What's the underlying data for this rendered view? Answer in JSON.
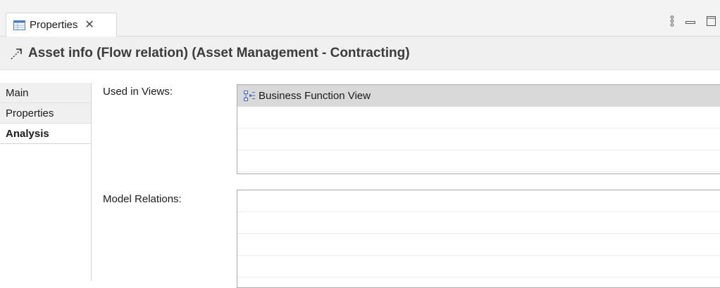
{
  "tabs": [
    {
      "label": "Properties",
      "icon": "properties-table-icon",
      "close_icon": "close-icon",
      "close_glyph": "✕"
    }
  ],
  "window_controls": [
    {
      "name": "view-menu-icon"
    },
    {
      "name": "minimize-icon"
    },
    {
      "name": "maximize-icon"
    }
  ],
  "header": {
    "icon": "flow-relation-arrow-icon",
    "title": "Asset info (Flow relation) (Asset Management - Contracting)"
  },
  "sidebar": {
    "items": [
      {
        "label": "Main",
        "active": false
      },
      {
        "label": "Properties",
        "active": false
      },
      {
        "label": "Analysis",
        "active": true
      }
    ]
  },
  "main": {
    "used_in_views": {
      "label": "Used in Views:",
      "items": [
        {
          "icon": "view-diagram-icon",
          "text": "Business Function View",
          "selected": true
        }
      ]
    },
    "model_relations": {
      "label": "Model Relations:",
      "items": []
    }
  },
  "colors": {
    "selection": "#d9d9d9",
    "icon_blue": "#2e6db4",
    "tab_icon_blue": "#4a7ebf"
  }
}
